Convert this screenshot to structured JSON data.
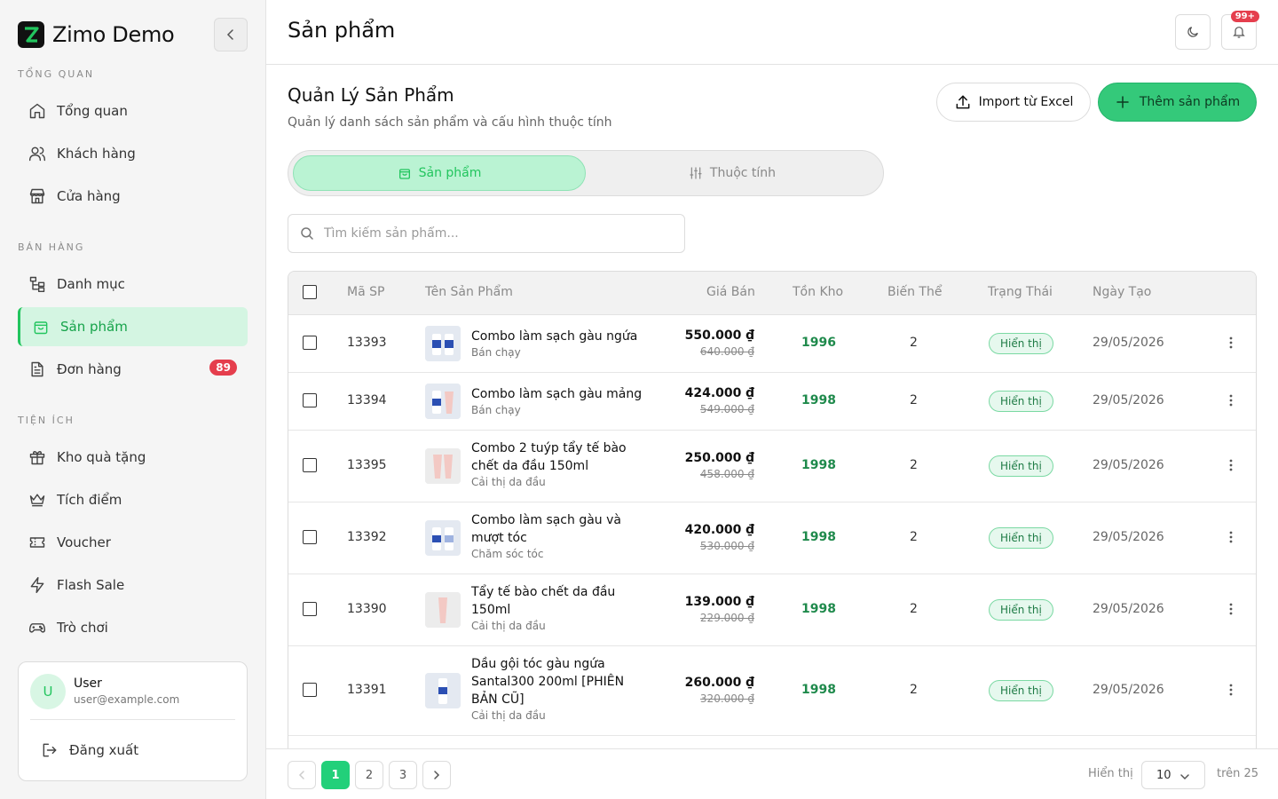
{
  "brand": {
    "name": "Zimo Demo"
  },
  "sidebar": {
    "sections": [
      {
        "label": "TỔNG QUAN"
      },
      {
        "label": "BÁN HÀNG"
      },
      {
        "label": "TIỆN ÍCH"
      }
    ],
    "items": [
      {
        "label": "Tổng quan",
        "icon": "home-icon"
      },
      {
        "label": "Khách hàng",
        "icon": "users-icon"
      },
      {
        "label": "Cửa hàng",
        "icon": "store-icon"
      },
      {
        "label": "Danh mục",
        "icon": "category-icon"
      },
      {
        "label": "Sản phẩm",
        "icon": "bag-icon",
        "active": true
      },
      {
        "label": "Đơn hàng",
        "icon": "document-icon",
        "badge": "89"
      },
      {
        "label": "Kho quà tặng",
        "icon": "gift-icon"
      },
      {
        "label": "Tích điểm",
        "icon": "crown-icon"
      },
      {
        "label": "Voucher",
        "icon": "ticket-icon"
      },
      {
        "label": "Flash Sale",
        "icon": "lightning-icon"
      },
      {
        "label": "Trò chơi",
        "icon": "gamepad-icon"
      }
    ],
    "user": {
      "initial": "U",
      "name": "User",
      "email": "user@example.com",
      "logout_label": "Đăng xuất"
    }
  },
  "header": {
    "title": "Sản phẩm",
    "notification_badge": "99+"
  },
  "main": {
    "title": "Quản Lý Sản Phẩm",
    "subtitle": "Quản lý danh sách sản phẩm và cấu hình thuộc tính",
    "import_label": "Import từ Excel",
    "add_label": "Thêm sản phẩm",
    "tabs": [
      {
        "label": "Sản phẩm"
      },
      {
        "label": "Thuộc tính"
      }
    ],
    "search_placeholder": "Tìm kiếm sản phẩm..."
  },
  "table": {
    "headers": {
      "code": "Mã SP",
      "name": "Tên Sản Phẩm",
      "price": "Giá Bán",
      "stock": "Tồn Kho",
      "variants": "Biến Thể",
      "status": "Trạng Thái",
      "date": "Ngày Tạo"
    },
    "rows": [
      {
        "code": "13393",
        "name": "Combo làm sạch gàu ngứa",
        "category": "Bán chạy",
        "price": "550.000 ₫",
        "old_price": "640.000 ₫",
        "stock": "1996",
        "variants": "2",
        "status": "Hiển thị",
        "date": "29/05/2026",
        "thumb": "two-blue-bottles"
      },
      {
        "code": "13394",
        "name": "Combo làm sạch gàu mảng",
        "category": "Bán chạy",
        "price": "424.000 ₫",
        "old_price": "549.000 ₫",
        "stock": "1998",
        "variants": "2",
        "status": "Hiển thị",
        "date": "29/05/2026",
        "thumb": "blue-bottle-pink-tube"
      },
      {
        "code": "13395",
        "name": "Combo 2 tuýp tẩy tế bào chết da đầu 150ml",
        "category": "Cải thị da đầu",
        "price": "250.000 ₫",
        "old_price": "458.000 ₫",
        "stock": "1998",
        "variants": "2",
        "status": "Hiển thị",
        "date": "29/05/2026",
        "thumb": "two-pink-tubes"
      },
      {
        "code": "13392",
        "name": "Combo làm sạch gàu và mượt tóc",
        "category": "Chăm sóc tóc",
        "price": "420.000 ₫",
        "old_price": "530.000 ₫",
        "stock": "1998",
        "variants": "2",
        "status": "Hiển thị",
        "date": "29/05/2026",
        "thumb": "blue-and-white-bottles"
      },
      {
        "code": "13390",
        "name": "Tẩy tế bào chết da đầu 150ml",
        "category": "Cải thị da đầu",
        "price": "139.000 ₫",
        "old_price": "229.000 ₫",
        "stock": "1998",
        "variants": "2",
        "status": "Hiển thị",
        "date": "29/05/2026",
        "thumb": "pink-tube"
      },
      {
        "code": "13391",
        "name": "Dầu gội tóc gàu ngứa Santal300 200ml [PHIÊN BẢN CŨ]",
        "category": "Cải thị da đầu",
        "price": "260.000 ₫",
        "old_price": "320.000 ₫",
        "stock": "1998",
        "variants": "2",
        "status": "Hiển thị",
        "date": "29/05/2026",
        "thumb": "white-bottle"
      }
    ]
  },
  "pagination": {
    "pages": [
      "1",
      "2",
      "3"
    ],
    "current": "1",
    "show_label": "Hiển thị",
    "page_size": "10",
    "total_label": "trên 25"
  },
  "colors": {
    "accent": "#22c55e",
    "accent_light": "#d4f5e2",
    "badge": "#e53e4d",
    "stock": "#1f8a4c"
  }
}
